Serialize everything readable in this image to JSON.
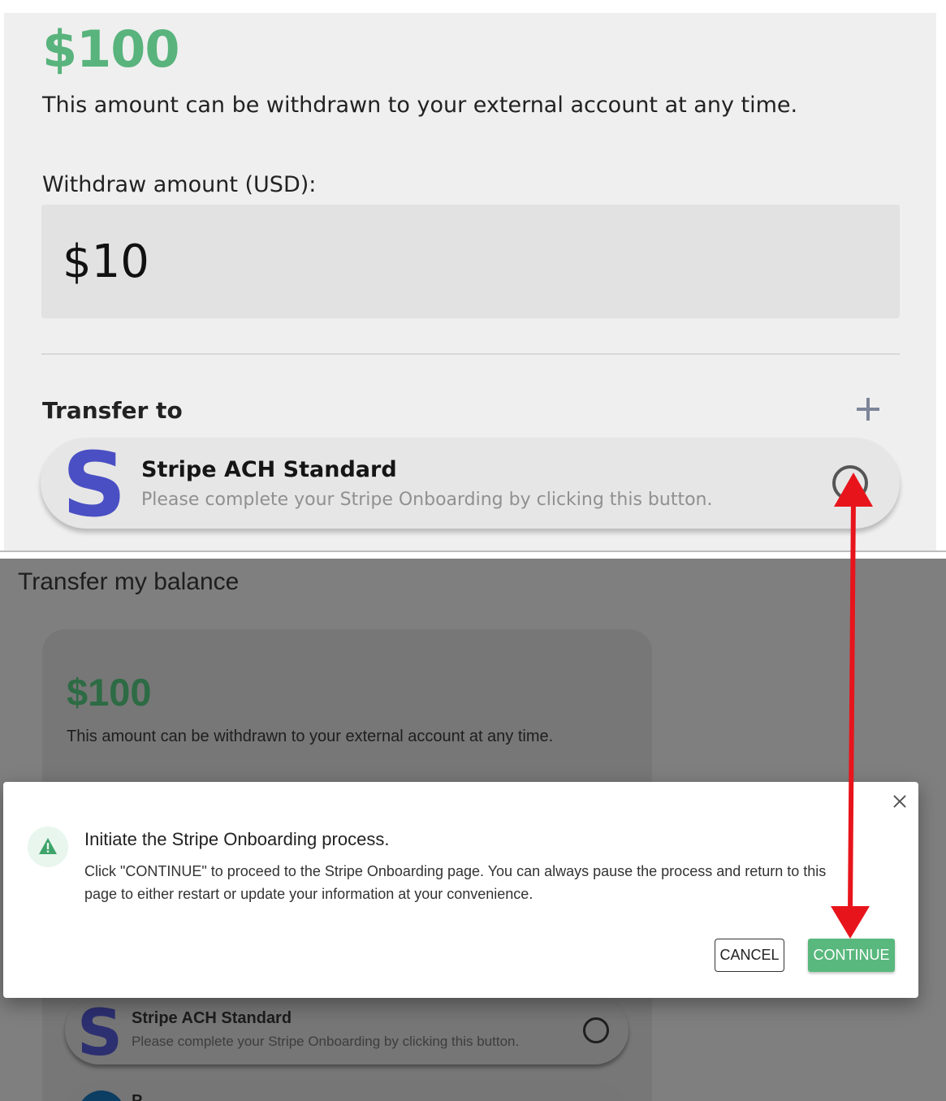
{
  "top_view": {
    "amount": "$100",
    "description": "This amount can be withdrawn to your external account at any time.",
    "withdraw_label": "Withdraw amount (USD):",
    "withdraw_value": "$10",
    "transfer_to_label": "Transfer to",
    "account": {
      "logo_letter": "S",
      "title": "Stripe ACH Standard",
      "subtitle": "Please complete your Stripe Onboarding by clicking this button."
    }
  },
  "page": {
    "title": "Transfer my balance",
    "amount": "$100",
    "description": "This amount can be withdrawn to your external account at any time.",
    "account": {
      "logo_letter": "S",
      "title": "Stripe ACH Standard",
      "subtitle": "Please complete your Stripe Onboarding by clicking this button."
    },
    "account_2": {
      "title": "P"
    }
  },
  "dialog": {
    "title": "Initiate the Stripe Onboarding process.",
    "message": "Click \"CONTINUE\" to proceed to the Stripe Onboarding page. You can always pause the process and return to this page to either restart or update your information at your convenience.",
    "cancel_label": "CANCEL",
    "continue_label": "CONTINUE",
    "icon": "warning-icon"
  },
  "colors": {
    "accent_green": "#58b37c",
    "stripe_blue": "#4a4fc4",
    "arrow_red": "#e8141b"
  }
}
